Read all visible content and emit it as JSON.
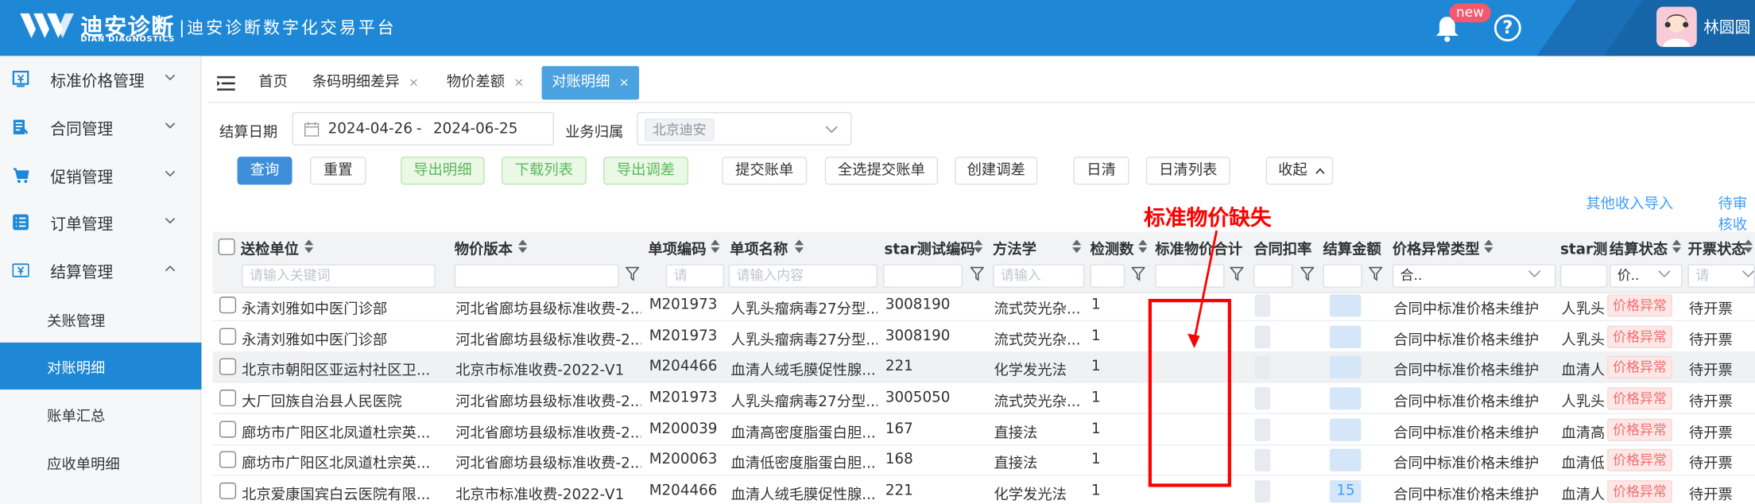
{
  "header": {
    "brand": "迪安诊断",
    "brand_sub": "DIAN DIAGNOSTICS",
    "platform": "|迪安诊断数字化交易平台",
    "new_badge": "new",
    "help": "?",
    "user": "林圆圆"
  },
  "sidebar": {
    "items": [
      {
        "label": "标准价格管理",
        "icon": "price-doc-icon"
      },
      {
        "label": "合同管理",
        "icon": "contract-icon"
      },
      {
        "label": "促销管理",
        "icon": "cart-icon"
      },
      {
        "label": "订单管理",
        "icon": "list-icon"
      },
      {
        "label": "结算管理",
        "icon": "yen-icon"
      }
    ],
    "sub_items": [
      {
        "label": "关账管理",
        "active": false
      },
      {
        "label": "对账明细",
        "active": true
      },
      {
        "label": "账单汇总",
        "active": false
      },
      {
        "label": "应收单明细",
        "active": false
      }
    ]
  },
  "tabs": [
    {
      "label": "首页",
      "closable": false
    },
    {
      "label": "条码明细差异",
      "closable": true
    },
    {
      "label": "物价差额",
      "closable": true
    },
    {
      "label": "对账明细",
      "closable": true,
      "active": true
    }
  ],
  "tab_close": "×",
  "filters": {
    "date_label": "结算日期",
    "date_start": "2024-04-26",
    "date_sep": "-",
    "date_end": "2024-06-25",
    "biz_label": "业务归属",
    "biz_value": "北京迪安"
  },
  "buttons": {
    "query": "查询",
    "reset": "重置",
    "export_detail": "导出明细",
    "download_list": "下载列表",
    "export_adjust": "导出调差",
    "submit_bill": "提交账单",
    "select_all_submit": "全选提交账单",
    "create_adjust": "创建调差",
    "daily_clear": "日清",
    "daily_clear_list": "日清列表",
    "collapse": "收起"
  },
  "links": {
    "other_income": "其他收入导入",
    "pending_review": "待审核收入"
  },
  "annotation": "标准物价缺失",
  "table": {
    "columns": [
      {
        "label": "送检单位",
        "placeholder": "请输入关键词"
      },
      {
        "label": "物价版本",
        "placeholder": ""
      },
      {
        "label": "单项编码",
        "placeholder": "请"
      },
      {
        "label": "单项名称",
        "placeholder": "请输入内容"
      },
      {
        "label": "star测试编码",
        "placeholder": ""
      },
      {
        "label": "方法学",
        "placeholder": "请输入"
      },
      {
        "label": "检测数",
        "placeholder": ""
      },
      {
        "label": "标准物价合计",
        "placeholder": ""
      },
      {
        "label": "合同扣率",
        "placeholder": ""
      },
      {
        "label": "结算金额",
        "placeholder": ""
      },
      {
        "label": "价格异常类型",
        "placeholder": "合.."
      },
      {
        "label": "star测试",
        "placeholder": ""
      },
      {
        "label": "结算状态",
        "placeholder": "价.."
      },
      {
        "label": "开票状态",
        "placeholder": "请"
      }
    ],
    "rows": [
      [
        "永清刘雅如中医门诊部",
        "河北省廊坊县级标准收费-2...",
        "M201973",
        "人乳头瘤病毒27分型...",
        "3008190",
        "流式荧光杂...",
        "1",
        "",
        "",
        "",
        "合同中标准价格未维护",
        "人乳头",
        "价格异常",
        "待开票"
      ],
      [
        "永清刘雅如中医门诊部",
        "河北省廊坊县级标准收费-2...",
        "M201973",
        "人乳头瘤病毒27分型...",
        "3008190",
        "流式荧光杂...",
        "1",
        "",
        "",
        "",
        "合同中标准价格未维护",
        "人乳头",
        "价格异常",
        "待开票"
      ],
      [
        "北京市朝阳区亚运村社区卫...",
        "北京市标准收费-2022-V1",
        "M204466",
        "血清人绒毛膜促性腺...",
        "221",
        "化学发光法",
        "1",
        "",
        "",
        "",
        "合同中标准价格未维护",
        "血清人",
        "价格异常",
        "待开票"
      ],
      [
        "大厂回族自治县人民医院",
        "河北省廊坊县级标准收费-2...",
        "M201973",
        "人乳头瘤病毒27分型...",
        "3005050",
        "流式荧光杂...",
        "1",
        "",
        "",
        "",
        "合同中标准价格未维护",
        "人乳头",
        "价格异常",
        "待开票"
      ],
      [
        "廊坊市广阳区北凤道杜宗英...",
        "河北省廊坊县级标准收费-2...",
        "M200039",
        "血清高密度脂蛋白胆...",
        "167",
        "直接法",
        "1",
        "",
        "",
        "",
        "合同中标准价格未维护",
        "血清高",
        "价格异常",
        "待开票"
      ],
      [
        "廊坊市广阳区北凤道杜宗英...",
        "河北省廊坊县级标准收费-2...",
        "M200063",
        "血清低密度脂蛋白胆...",
        "168",
        "直接法",
        "1",
        "",
        "",
        "",
        "合同中标准价格未维护",
        "血清低",
        "价格异常",
        "待开票"
      ],
      [
        "北京爱康国宾白云医院有限...",
        "北京市标准收费-2022-V1",
        "M204466",
        "血清人绒毛膜促性腺...",
        "221",
        "化学发光法",
        "1",
        "",
        "",
        "15",
        "合同中标准价格未维护",
        "血清人",
        "价格异常",
        "待开票"
      ]
    ]
  },
  "colors": {
    "header_bg": "#1e88d6",
    "active_blue": "#1e88d6",
    "primary_btn": "#3d8fd9",
    "green_btn_text": "#5cb85c",
    "danger": "#f56c6c",
    "annotation_red": "#ff0000"
  }
}
